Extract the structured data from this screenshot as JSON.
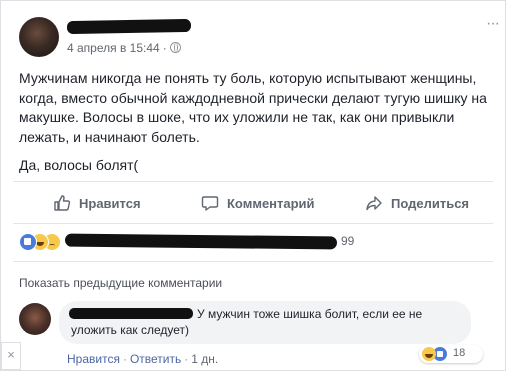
{
  "post": {
    "timestamp": "4 апреля в 15:44",
    "text_paragraphs": [
      "Мужчинам никогда не понять ту боль, которую испытывают женщины, когда, вместо обычной каждодневной прически делают тугую шишку на макушке. Волосы в шоке, что их уложили не так, как они привыкли лежать, и начинают болеть.",
      "Да, волосы болят("
    ],
    "more_label": "···"
  },
  "actions": {
    "like_label": "Нравится",
    "comment_label": "Комментарий",
    "share_label": "Поделиться"
  },
  "reactions": {
    "count": "99"
  },
  "comments": {
    "show_previous_label": "Показать предыдущие комментарии",
    "item": {
      "text": "У мужчин тоже шишка болит, если ее не уложить как следует)",
      "like_label": "Нравится",
      "reply_label": "Ответить",
      "separator": "·",
      "time": "1 дн.",
      "reaction_count": "18"
    }
  },
  "overlay": {
    "close_symbol": "×"
  },
  "colors": {
    "link": "#4b67a1",
    "like_blue": "#4a7bd9",
    "haha_yellow": "#f7c84a"
  }
}
